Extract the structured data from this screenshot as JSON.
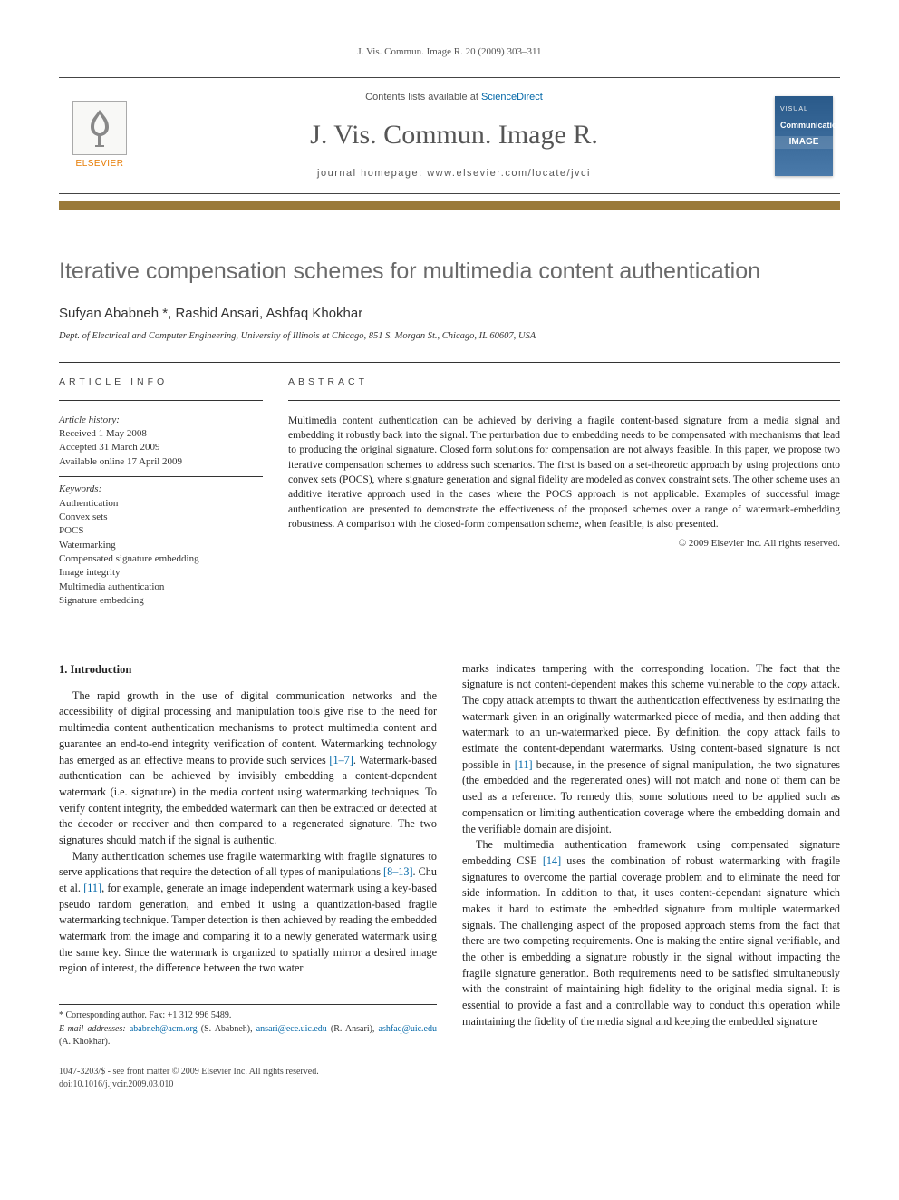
{
  "running_head": "J. Vis. Commun. Image R. 20 (2009) 303–311",
  "masthead": {
    "contents_prefix": "Contents lists available at ",
    "contents_link": "ScienceDirect",
    "journal": "J. Vis. Commun. Image R.",
    "homepage_prefix": "journal homepage: ",
    "homepage_url": "www.elsevier.com/locate/jvci",
    "elsevier_label": "ELSEVIER",
    "cover_line1": "VISUAL",
    "cover_line2": "Communication",
    "cover_band": "IMAGE"
  },
  "title": "Iterative compensation schemes for multimedia content authentication",
  "authors": "Sufyan Ababneh *, Rashid Ansari, Ashfaq Khokhar",
  "affiliation": "Dept. of Electrical and Computer Engineering, University of Illinois at Chicago, 851 S. Morgan St., Chicago, IL 60607, USA",
  "article_info_label": "article info",
  "abstract_label": "abstract",
  "history": {
    "label": "Article history:",
    "received": "Received 1 May 2008",
    "accepted": "Accepted 31 March 2009",
    "online": "Available online 17 April 2009"
  },
  "keywords_label": "Keywords:",
  "keywords": [
    "Authentication",
    "Convex sets",
    "POCS",
    "Watermarking",
    "Compensated signature embedding",
    "Image integrity",
    "Multimedia authentication",
    "Signature embedding"
  ],
  "abstract": "Multimedia content authentication can be achieved by deriving a fragile content-based signature from a media signal and embedding it robustly back into the signal. The perturbation due to embedding needs to be compensated with mechanisms that lead to producing the original signature. Closed form solutions for compensation are not always feasible. In this paper, we propose two iterative compensation schemes to address such scenarios. The first is based on a set-theoretic approach by using projections onto convex sets (POCS), where signature generation and signal fidelity are modeled as convex constraint sets. The other scheme uses an additive iterative approach used in the cases where the POCS approach is not applicable. Examples of successful image authentication are presented to demonstrate the effectiveness of the proposed schemes over a range of watermark-embedding robustness. A comparison with the closed-form compensation scheme, when feasible, is also presented.",
  "copyright": "© 2009 Elsevier Inc. All rights reserved.",
  "section1_heading": "1. Introduction",
  "body": {
    "c1p1a": "The rapid growth in the use of digital communication networks and the accessibility of digital processing and manipulation tools give rise to the need for multimedia content authentication mechanisms to protect multimedia content and guarantee an end-to-end integrity verification of content. Watermarking technology has emerged as an effective means to provide such services ",
    "c1ref1": "[1–7]",
    "c1p1b": ". Watermark-based authentication can be achieved by invisibly embedding a content-dependent watermark (i.e. signature) in the media content using watermarking techniques. To verify content integrity, the embedded watermark can then be extracted or detected at the decoder or receiver and then compared to a regenerated signature. The two signatures should match if the signal is authentic.",
    "c1p2a": "Many authentication schemes use fragile watermarking with fragile signatures to serve applications that require the detection of all types of manipulations ",
    "c1ref2": "[8–13]",
    "c1p2b": ". Chu et al. ",
    "c1ref3": "[11]",
    "c1p2c": ", for example, generate an image independent watermark using a key-based pseudo random generation, and embed it using a quantization-based fragile watermarking technique. Tamper detection is then achieved by reading the embedded watermark from the image and comparing it to a newly generated watermark using the same key. Since the watermark is organized to spatially mirror a desired image region of interest, the difference between the two water",
    "c2p1a": "marks indicates tampering with the corresponding location. The fact that the signature is not content-dependent makes this scheme vulnerable to the ",
    "c2em1": "copy",
    "c2p1b": " attack. The copy attack attempts to thwart the authentication effectiveness by estimating the watermark given in an originally watermarked piece of media, and then adding that watermark to an un-watermarked piece. By definition, the copy attack fails to estimate the content-dependant watermarks. Using content-based signature is not possible in ",
    "c2ref1": "[11]",
    "c2p1c": " because, in the presence of signal manipulation, the two signatures (the embedded and the regenerated ones) will not match and none of them can be used as a reference. To remedy this, some solutions need to be applied such as compensation or limiting authentication coverage where the embedding domain and the verifiable domain are disjoint.",
    "c2p2a": "The multimedia authentication framework using compensated signature embedding CSE ",
    "c2ref2": "[14]",
    "c2p2b": " uses the combination of robust watermarking with fragile signatures to overcome the partial coverage problem and to eliminate the need for side information. In addition to that, it uses content-dependant signature which makes it hard to estimate the embedded signature from multiple watermarked signals. The challenging aspect of the proposed approach stems from the fact that there are two competing requirements. One is making the entire signal verifiable, and the other is embedding a signature robustly in the signal without impacting the fragile signature generation. Both requirements need to be satisfied simultaneously with the constraint of maintaining high fidelity to the original media signal. It is essential to provide a fast and a controllable way to conduct this operation while maintaining the fidelity of the media signal and keeping the embedded signature"
  },
  "footnotes": {
    "corr": "* Corresponding author. Fax: +1 312 996 5489.",
    "email_label": "E-mail addresses:",
    "email1": "ababneh@acm.org",
    "name1": " (S. Ababneh), ",
    "email2": "ansari@ece.uic.edu",
    "name2": " (R. Ansari), ",
    "email3": "ashfaq@uic.edu",
    "name3": " (A. Khokhar)."
  },
  "bottom": {
    "line1": "1047-3203/$ - see front matter © 2009 Elsevier Inc. All rights reserved.",
    "line2": "doi:10.1016/j.jvcir.2009.03.010"
  }
}
